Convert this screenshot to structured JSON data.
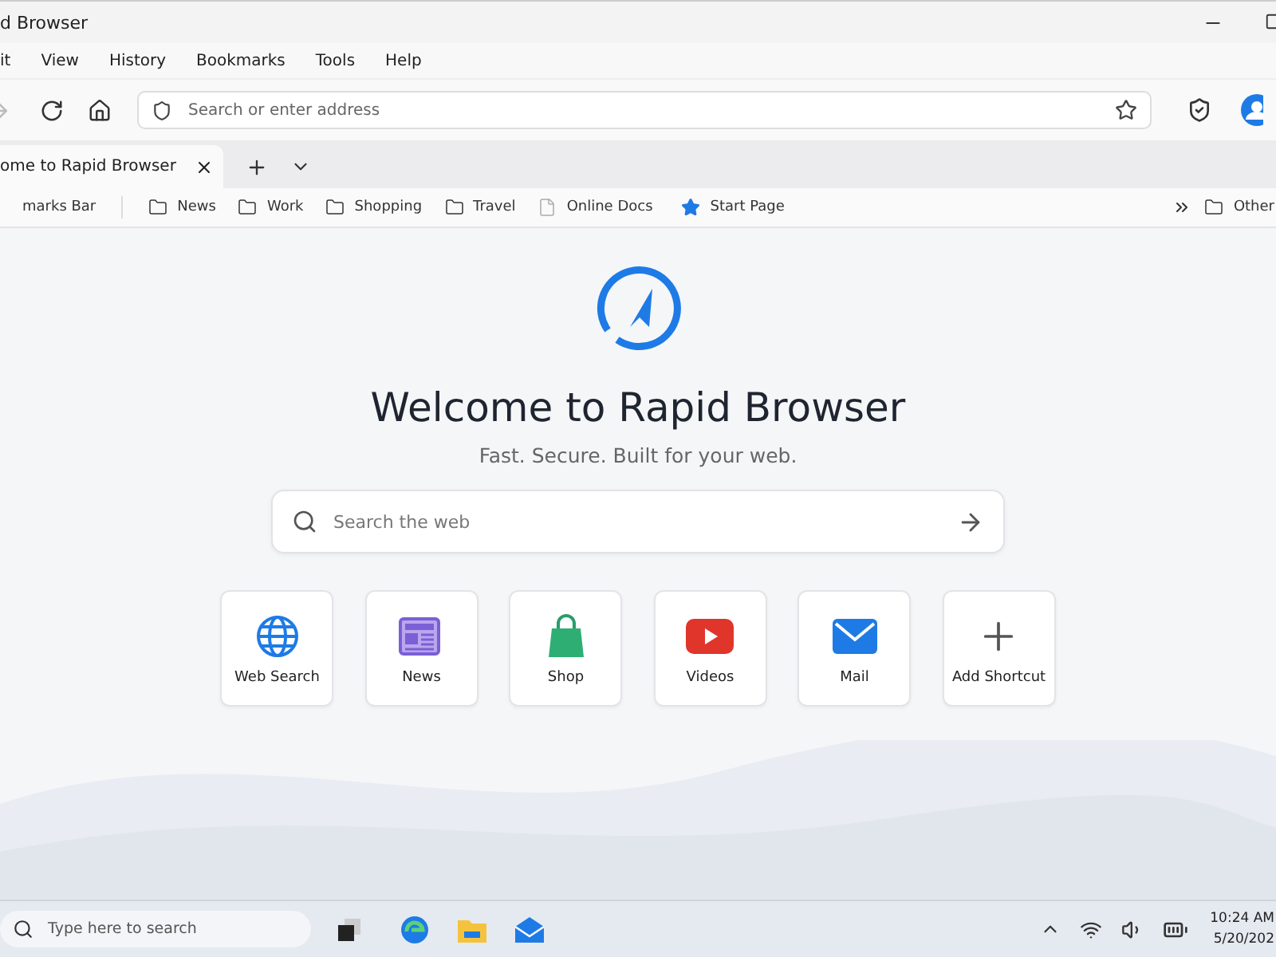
{
  "window": {
    "title": "d Browser"
  },
  "menu": [
    "it",
    "View",
    "History",
    "Bookmarks",
    "Tools",
    "Help"
  ],
  "toolbar": {
    "forward_disabled": true,
    "address_placeholder": "Search or enter address"
  },
  "tabs": [
    {
      "label": "ome to Rapid Browser",
      "selected": true
    }
  ],
  "bookmarks_bar": {
    "label": "marks Bar",
    "items": [
      {
        "label": "News",
        "kind": "folder"
      },
      {
        "label": "Work",
        "kind": "folder"
      },
      {
        "label": "Shopping",
        "kind": "folder"
      },
      {
        "label": "Travel",
        "kind": "folder"
      },
      {
        "label": "Online Docs",
        "kind": "page"
      },
      {
        "label": "Start Page",
        "kind": "star"
      }
    ],
    "other": "Other"
  },
  "page": {
    "heading": "Welcome to Rapid Browser",
    "tagline": "Fast. Secure. Built for your web.",
    "search_placeholder": "Search the web",
    "shortcuts": [
      {
        "label": "Web Search",
        "kind": "globe"
      },
      {
        "label": "News",
        "kind": "news"
      },
      {
        "label": "Shop",
        "kind": "shop"
      },
      {
        "label": "Videos",
        "kind": "video"
      },
      {
        "label": "Mail",
        "kind": "mail"
      },
      {
        "label": "Add Shortcut",
        "kind": "add"
      }
    ]
  },
  "taskbar": {
    "search_placeholder": "Type here to search",
    "time": "10:24 AM",
    "date": "5/20/202"
  }
}
